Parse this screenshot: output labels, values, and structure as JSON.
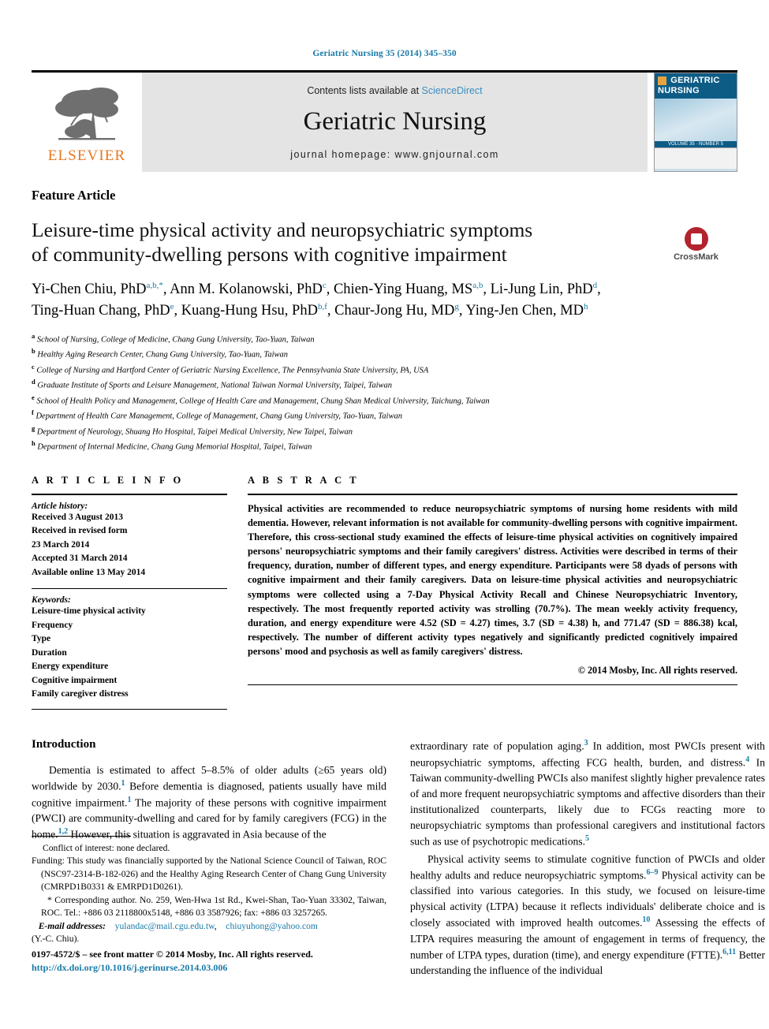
{
  "running_head": "Geriatric Nursing 35 (2014) 345–350",
  "masthead": {
    "publisher_logo_label": "ELSEVIER",
    "contents_prefix": "Contents lists available at ",
    "contents_link": "ScienceDirect",
    "journal_title": "Geriatric Nursing",
    "homepage": "journal homepage: www.gnjournal.com",
    "cover": {
      "brand_line1": "GERIATRIC",
      "brand_line2": "NURSING",
      "strip_text": "VOLUME 35 · NUMBER 5"
    }
  },
  "article": {
    "type_label": "Feature Article",
    "title_line1": "Leisure-time physical activity and neuropsychiatric symptoms",
    "title_line2": "of community-dwelling persons with cognitive impairment",
    "crossmark_label": "CrossMark",
    "authors": [
      {
        "name": "Yi-Chen Chiu, PhD",
        "marks": "a,b,*",
        "sep": ", "
      },
      {
        "name": "Ann M. Kolanowski, PhD",
        "marks": "c",
        "sep": ", "
      },
      {
        "name": "Chien-Ying Huang, MS",
        "marks": "a,b",
        "sep": ", "
      },
      {
        "name": "Li-Jung Lin, PhD",
        "marks": "d",
        "sep": ", "
      },
      {
        "name": "Ting-Huan Chang, PhD",
        "marks": "e",
        "sep": ", "
      },
      {
        "name": "Kuang-Hung Hsu, PhD",
        "marks": "b,f",
        "sep": ", "
      },
      {
        "name": "Chaur-Jong Hu, MD",
        "marks": "g",
        "sep": ", "
      },
      {
        "name": "Ying-Jen Chen, MD",
        "marks": "h",
        "sep": ""
      }
    ],
    "affiliations": [
      {
        "mark": "a",
        "text": "School of Nursing, College of Medicine, Chang Gung University, Tao-Yuan, Taiwan"
      },
      {
        "mark": "b",
        "text": "Healthy Aging Research Center, Chang Gung University, Tao-Yuan, Taiwan"
      },
      {
        "mark": "c",
        "text": "College of Nursing and Hartford Center of Geriatric Nursing Excellence, The Pennsylvania State University, PA, USA"
      },
      {
        "mark": "d",
        "text": "Graduate Institute of Sports and Leisure Management, National Taiwan Normal University, Taipei, Taiwan"
      },
      {
        "mark": "e",
        "text": "School of Health Policy and Management, College of Health Care and Management, Chung Shan Medical University, Taichung, Taiwan"
      },
      {
        "mark": "f",
        "text": "Department of Health Care Management, College of Management, Chang Gung University, Tao-Yuan, Taiwan"
      },
      {
        "mark": "g",
        "text": "Department of Neurology, Shuang Ho Hospital, Taipei Medical University, New Taipei, Taiwan"
      },
      {
        "mark": "h",
        "text": "Department of Internal Medicine, Chang Gung Memorial Hospital, Taipei, Taiwan"
      }
    ]
  },
  "article_info": {
    "heading": "A R T I C L E  I N F O",
    "history_label": "Article history:",
    "history": [
      "Received 3 August 2013",
      "Received in revised form",
      "23 March 2014",
      "Accepted 31 March 2014",
      "Available online 13 May 2014"
    ],
    "keywords_label": "Keywords:",
    "keywords": [
      "Leisure-time physical activity",
      "Frequency",
      "Type",
      "Duration",
      "Energy expenditure",
      "Cognitive impairment",
      "Family caregiver distress"
    ]
  },
  "abstract": {
    "heading": "A B S T R A C T",
    "text": "Physical activities are recommended to reduce neuropsychiatric symptoms of nursing home residents with mild dementia. However, relevant information is not available for community-dwelling persons with cognitive impairment. Therefore, this cross-sectional study examined the effects of leisure-time physical activities on cognitively impaired persons' neuropsychiatric symptoms and their family caregivers' distress. Activities were described in terms of their frequency, duration, number of different types, and energy expenditure. Participants were 58 dyads of persons with cognitive impairment and their family caregivers. Data on leisure-time physical activities and neuropsychiatric symptoms were collected using a 7-Day Physical Activity Recall and Chinese Neuropsychiatric Inventory, respectively. The most frequently reported activity was strolling (70.7%). The mean weekly activity frequency, duration, and energy expenditure were 4.52 (SD = 4.27) times, 3.7 (SD = 4.38) h, and 771.47 (SD = 886.38) kcal, respectively. The number of different activity types negatively and significantly predicted cognitively impaired persons' mood and psychosis as well as family caregivers' distress.",
    "copyright": "© 2014 Mosby, Inc. All rights reserved."
  },
  "introduction": {
    "heading": "Introduction",
    "left_paragraph_1_parts": [
      {
        "t": "Dementia is estimated to affect 5–8.5% of older adults (≥65 years old) worldwide by 2030."
      },
      {
        "sup": "1"
      },
      {
        "t": " Before dementia is diagnosed, patients usually have mild cognitive impairment."
      },
      {
        "sup": "1"
      },
      {
        "t": " The majority of these persons with cognitive impairment (PWCI) are community-dwelling and cared for by family caregivers (FCG) in the home."
      },
      {
        "sup": "1,2"
      },
      {
        "t": " However, this situation is aggravated in Asia because of the"
      }
    ],
    "right_paragraph_1_parts": [
      {
        "t": "extraordinary rate of population aging."
      },
      {
        "sup": "3"
      },
      {
        "t": " In addition, most PWCIs present with neuropsychiatric symptoms, affecting FCG health, burden, and distress."
      },
      {
        "sup": "4"
      },
      {
        "t": " In Taiwan community-dwelling PWCIs also manifest slightly higher prevalence rates of and more frequent neuropsychiatric symptoms and affective disorders than their institutionalized counterparts, likely due to FCGs reacting more to neuropsychiatric symptoms than professional caregivers and institutional factors such as use of psychotropic medications."
      },
      {
        "sup": "5"
      }
    ],
    "right_paragraph_2_parts": [
      {
        "t": "Physical activity seems to stimulate cognitive function of PWCIs and older healthy adults and reduce neuropsychiatric symptoms."
      },
      {
        "sup": "6–9"
      },
      {
        "t": " Physical activity can be classified into various categories. In this study, we focused on leisure-time physical activity (LTPA) because it reflects individuals' deliberate choice and is closely associated with improved health outcomes."
      },
      {
        "sup": "10"
      },
      {
        "t": " Assessing the effects of LTPA requires measuring the amount of engagement in terms of frequency, the number of LTPA types, duration (time), and energy expenditure (FTTE)."
      },
      {
        "sup": "6,11"
      },
      {
        "t": " Better understanding the influence of the individual"
      }
    ]
  },
  "footnotes": {
    "conflict": "Conflict of interest: none declared.",
    "funding": "Funding: This study was financially supported by the National Science Council of Taiwan, ROC (NSC97-2314-B-182-026) and the Healthy Aging Research Center of Chang Gung University (CMRPD1B0331 & EMRPD1D0261).",
    "corresponding": "* Corresponding author. No. 259, Wen-Hwa 1st Rd., Kwei-Shan, Tao-Yuan 33302, Taiwan, ROC. Tel.: +886 03 2118800x5148, +886 03 3587926; fax: +886 03 3257265.",
    "email_label": "E-mail addresses:",
    "email_1": "yulandac@mail.cgu.edu.tw",
    "email_2": "chiuyuhong@yahoo.com",
    "email_owner": "(Y.-C. Chiu)."
  },
  "issn_line": {
    "text": "0197-4572/$ – see front matter © 2014 Mosby, Inc. All rights reserved.",
    "doi": "http://dx.doi.org/10.1016/j.gerinurse.2014.03.006"
  },
  "colors": {
    "link_blue": "#1a7aa8",
    "elsevier_orange": "#E87722",
    "crossmark_red": "#b2232e",
    "masthead_grey": "#e4e4e4"
  }
}
